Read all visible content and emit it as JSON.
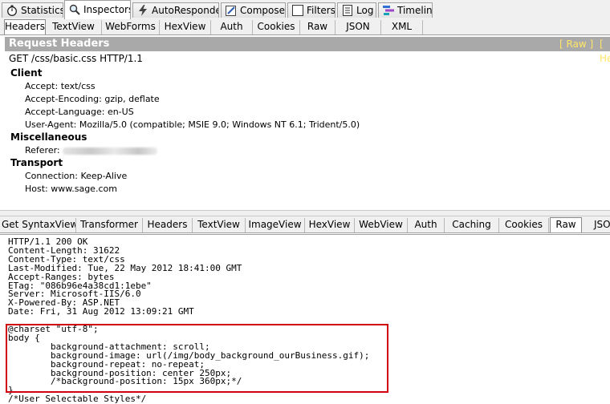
{
  "main_tabs": [
    {
      "label": "Statistics",
      "icon": "stopwatch-icon"
    },
    {
      "label": "Inspectors",
      "icon": "magnifier-icon"
    },
    {
      "label": "AutoResponder",
      "icon": "lightning-icon"
    },
    {
      "label": "Composer",
      "icon": "pencil-icon"
    },
    {
      "label": "Filters",
      "icon": "checkbox-icon"
    },
    {
      "label": "Log",
      "icon": "log-icon"
    },
    {
      "label": "Timeline",
      "icon": "timeline-icon"
    }
  ],
  "request_tabs": [
    "Headers",
    "TextView",
    "WebForms",
    "HexView",
    "Auth",
    "Cookies",
    "Raw",
    "JSON",
    "XML"
  ],
  "request": {
    "bar_title": "Request Headers",
    "raw_link": "[ Raw ]",
    "header_def_link": "[ He",
    "request_line": "GET /css/basic.css HTTP/1.1",
    "groups": [
      {
        "name": "Client",
        "headers": [
          "Accept: text/css",
          "Accept-Encoding: gzip, deflate",
          "Accept-Language: en-US",
          "User-Agent: Mozilla/5.0 (compatible; MSIE 9.0; Windows NT 6.1; Trident/5.0)"
        ]
      },
      {
        "name": "Miscellaneous",
        "headers": [
          "Referer:"
        ]
      },
      {
        "name": "Transport",
        "headers": [
          "Connection: Keep-Alive",
          "Host: www.sage.com"
        ]
      }
    ]
  },
  "response_tabs": [
    "Get SyntaxView",
    "Transformer",
    "Headers",
    "TextView",
    "ImageView",
    "HexView",
    "WebView",
    "Auth",
    "Caching",
    "Cookies",
    "Raw",
    "JSO"
  ],
  "response_raw": {
    "header_lines": [
      "HTTP/1.1 200 OK",
      "Content-Length: 31622",
      "Content-Type: text/css",
      "Last-Modified: Tue, 22 May 2012 18:41:00 GMT",
      "Accept-Ranges: bytes",
      "ETag: \"086b96e4a38cd1:1ebe\"",
      "Server: Microsoft-IIS/6.0",
      "X-Powered-By: ASP.NET",
      "Date: Fri, 31 Aug 2012 13:09:21 GMT"
    ],
    "body_lines": [
      "@charset \"utf-8\";",
      "body {",
      "        background-attachment: scroll;",
      "        background-image: url(/img/body_background_ourBusiness.gif);",
      "        background-repeat: no-repeat;",
      "        background-position: center 250px;",
      "        /*background-position: 15px 360px;*/",
      "}",
      "/*User Selectable Styles*/"
    ]
  }
}
